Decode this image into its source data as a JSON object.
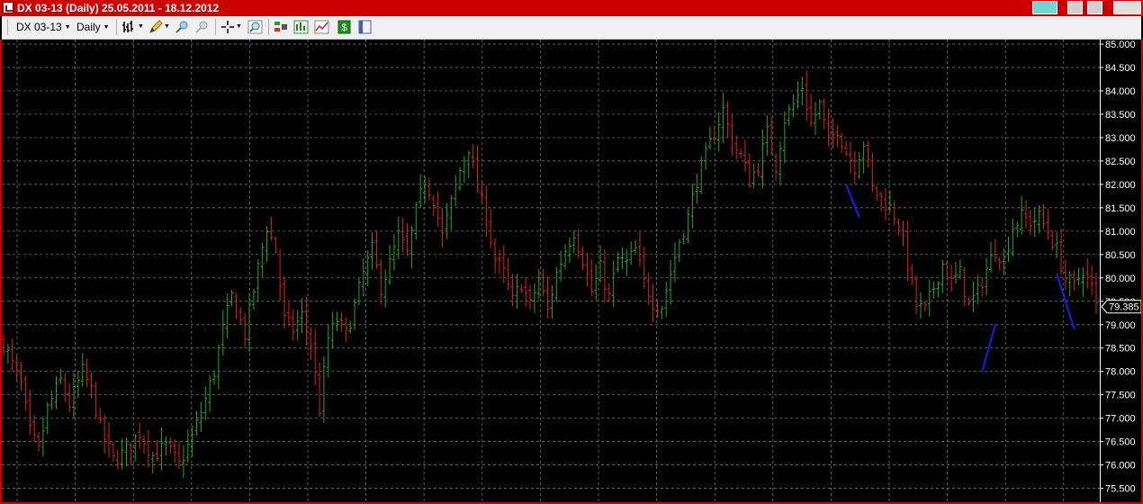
{
  "window": {
    "title": "DX 03-13 (Daily)  25.05.2011 - 18.12.2012"
  },
  "toolbar": {
    "symbol_label": "DX 03-13",
    "period_label": "Daily",
    "icons": [
      "bar-chart-style-icon",
      "pencil-draw-icon",
      "zoom-in-icon",
      "zoom-out-icon",
      "crosshair-icon",
      "magnifier-icon",
      "indicators-icon",
      "chart-type-icon",
      "compare-icon",
      "dollar-icon",
      "template-icon"
    ]
  },
  "colors": {
    "background": "#000000",
    "grid": "#808080",
    "up_bar": "#1fa81f",
    "down_bar": "#dd2020",
    "trendline": "#1a1aee",
    "frame": "#cc0000",
    "axis_text": "#ffffff"
  },
  "chart_data": {
    "type": "ohlc",
    "symbol": "DX 03-13",
    "period": "Daily",
    "date_range": [
      "25.05.2011",
      "18.12.2012"
    ],
    "ylim": [
      75.3,
      85.0
    ],
    "y_ticks": [
      "85.000",
      "84.500",
      "84.000",
      "83.500",
      "83.000",
      "82.500",
      "82.000",
      "81.500",
      "81.000",
      "80.500",
      "80.000",
      "79.500",
      "79.000",
      "78.500",
      "78.000",
      "77.500",
      "77.000",
      "76.500",
      "76.000",
      "75.500"
    ],
    "last_price": "79.385",
    "grid": true,
    "close_path": [
      [
        0,
        78.6
      ],
      [
        4,
        77.7
      ],
      [
        6,
        76.7
      ],
      [
        8,
        76.3
      ],
      [
        10,
        77.2
      ],
      [
        13,
        77.8
      ],
      [
        15,
        77.3
      ],
      [
        18,
        78.0
      ],
      [
        20,
        77.6
      ],
      [
        22,
        76.8
      ],
      [
        25,
        76.1
      ],
      [
        28,
        76.3
      ],
      [
        31,
        76.7
      ],
      [
        34,
        76.2
      ],
      [
        37,
        76.4
      ],
      [
        40,
        76.0
      ],
      [
        43,
        76.6
      ],
      [
        46,
        77.4
      ],
      [
        48,
        78.0
      ],
      [
        50,
        78.9
      ],
      [
        52,
        79.6
      ],
      [
        55,
        78.8
      ],
      [
        58,
        80.2
      ],
      [
        60,
        81.1
      ],
      [
        62,
        80.6
      ],
      [
        64,
        79.1
      ],
      [
        66,
        78.9
      ],
      [
        68,
        79.2
      ],
      [
        70,
        78.6
      ],
      [
        72,
        77.2
      ],
      [
        74,
        78.7
      ],
      [
        76,
        79.1
      ],
      [
        78,
        78.8
      ],
      [
        80,
        79.4
      ],
      [
        82,
        80.1
      ],
      [
        84,
        80.6
      ],
      [
        86,
        79.8
      ],
      [
        88,
        80.3
      ],
      [
        90,
        80.9
      ],
      [
        92,
        80.5
      ],
      [
        94,
        81.4
      ],
      [
        96,
        82.1
      ],
      [
        98,
        81.7
      ],
      [
        100,
        80.9
      ],
      [
        102,
        81.6
      ],
      [
        104,
        82.3
      ],
      [
        106,
        82.8
      ],
      [
        108,
        81.9
      ],
      [
        110,
        81.3
      ],
      [
        112,
        80.4
      ],
      [
        114,
        80.1
      ],
      [
        116,
        79.5
      ],
      [
        118,
        79.9
      ],
      [
        120,
        79.4
      ],
      [
        122,
        80.0
      ],
      [
        124,
        79.3
      ],
      [
        126,
        80.1
      ],
      [
        128,
        80.6
      ],
      [
        130,
        81.0
      ],
      [
        132,
        80.4
      ],
      [
        134,
        79.7
      ],
      [
        136,
        80.2
      ],
      [
        138,
        79.6
      ],
      [
        140,
        80.4
      ],
      [
        142,
        80.3
      ],
      [
        144,
        80.6
      ],
      [
        146,
        79.9
      ],
      [
        148,
        79.5
      ],
      [
        150,
        79.4
      ],
      [
        152,
        80.1
      ],
      [
        154,
        80.8
      ],
      [
        156,
        81.3
      ],
      [
        158,
        82.1
      ],
      [
        160,
        82.6
      ],
      [
        162,
        83.1
      ],
      [
        164,
        83.6
      ],
      [
        166,
        82.9
      ],
      [
        168,
        82.6
      ],
      [
        170,
        82.1
      ],
      [
        172,
        82.4
      ],
      [
        174,
        83.1
      ],
      [
        176,
        82.4
      ],
      [
        178,
        83.4
      ],
      [
        180,
        83.7
      ],
      [
        182,
        84.1
      ],
      [
        184,
        83.3
      ],
      [
        186,
        83.7
      ],
      [
        188,
        82.9
      ],
      [
        190,
        83.2
      ],
      [
        192,
        82.7
      ],
      [
        194,
        82.4
      ],
      [
        196,
        82.9
      ],
      [
        198,
        81.9
      ],
      [
        200,
        81.7
      ],
      [
        202,
        81.5
      ],
      [
        204,
        81.2
      ],
      [
        206,
        80.3
      ],
      [
        208,
        79.4
      ],
      [
        210,
        79.3
      ],
      [
        212,
        79.8
      ],
      [
        214,
        80.3
      ],
      [
        216,
        79.9
      ],
      [
        218,
        80.1
      ],
      [
        220,
        79.4
      ],
      [
        222,
        79.7
      ],
      [
        224,
        80.2
      ],
      [
        226,
        80.6
      ],
      [
        228,
        80.4
      ],
      [
        230,
        81.1
      ],
      [
        232,
        81.3
      ],
      [
        234,
        81.2
      ],
      [
        236,
        81.3
      ],
      [
        238,
        81.0
      ],
      [
        240,
        80.6
      ],
      [
        242,
        80.0
      ],
      [
        244,
        79.8
      ],
      [
        246,
        80.2
      ],
      [
        248,
        79.8
      ],
      [
        249,
        79.4
      ]
    ],
    "trendlines": [
      {
        "points": [
          [
            "bar",
            192,
            82.0
          ],
          [
            "bar",
            195,
            81.3
          ]
        ]
      },
      {
        "points": [
          [
            "bar",
            223,
            78.0
          ],
          [
            "bar",
            226,
            79.0
          ]
        ]
      },
      {
        "points": [
          [
            "bar",
            240,
            80.1
          ],
          [
            "bar",
            244,
            78.9
          ]
        ]
      }
    ]
  }
}
